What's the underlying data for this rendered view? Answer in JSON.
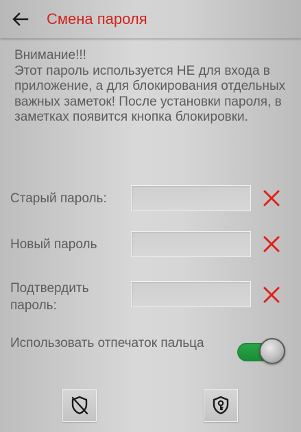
{
  "header": {
    "title": "Смена пароля",
    "back_icon": "arrow-left-icon",
    "title_color": "#d2231c"
  },
  "warning": {
    "text": "Внимание!!!\nЭтот пароль используется НЕ для входа в приложение, а для блокирования отдельных важных заметок! После установки пароля, в заметках появится кнопка блокировки."
  },
  "fields": {
    "old_password": {
      "label": "Старый пароль:",
      "value": "",
      "placeholder": ""
    },
    "new_password": {
      "label": "Новый пароль",
      "value": "",
      "placeholder": ""
    },
    "confirm_password": {
      "label": "Подтвердить\nпароль:",
      "value": "",
      "placeholder": ""
    },
    "clear_icon": "close-x-icon",
    "clear_color": "#e2201a"
  },
  "fingerprint": {
    "label": "Использовать отпечаток пальца",
    "enabled": true,
    "track_color": "#22a043"
  },
  "bottom_buttons": {
    "left_icon": "shield-off-icon",
    "right_icon": "shield-key-icon"
  }
}
